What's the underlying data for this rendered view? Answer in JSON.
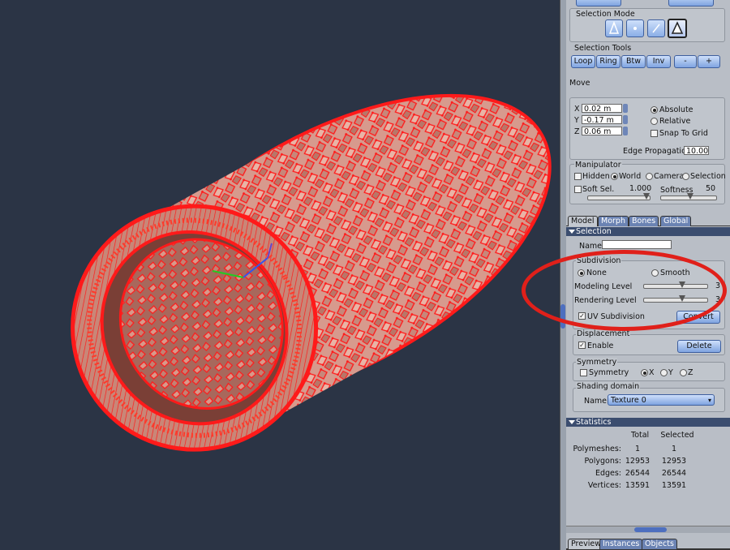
{
  "selection_mode": {
    "title": "Selection Mode",
    "icons": [
      "vertex-mode-icon",
      "point-mode-icon",
      "edge-mode-icon",
      "face-mode-icon"
    ],
    "active": "face-mode-icon"
  },
  "selection_tools": {
    "title": "Selection Tools",
    "buttons": [
      "Loop",
      "Ring",
      "Btw",
      "Inv",
      "-",
      "+"
    ]
  },
  "move": {
    "title": "Move",
    "x_label": "X",
    "x": "0.02 m",
    "y_label": "Y",
    "y": "-0.17 m",
    "z_label": "Z",
    "z": "0.06 m",
    "absolute": "Absolute",
    "relative": "Relative",
    "snap": "Snap To Grid",
    "edge_prop_label": "Edge Propagation",
    "edge_prop": "10.00"
  },
  "manipulator": {
    "title": "Manipulator",
    "hidden": "Hidden",
    "world": "World",
    "camera": "Camera",
    "selection": "Selection",
    "soft_sel": "Soft Sel.",
    "soft_val": "1.000",
    "softness": "Softness",
    "softness_val": "50"
  },
  "tabs": [
    "Model",
    "Morph",
    "Bones",
    "Global"
  ],
  "selection": {
    "header": "Selection",
    "name_label": "Name",
    "name_value": ""
  },
  "subdivision": {
    "title": "Subdivision",
    "none": "None",
    "smooth": "Smooth",
    "modeling_level_label": "Modeling Level",
    "modeling_level": "3",
    "modeling_level_fraction": 0.6,
    "rendering_level_label": "Rendering Level",
    "rendering_level": "3",
    "rendering_level_fraction": 0.6,
    "uv_subdivision": "UV Subdivision",
    "convert": "Convert"
  },
  "displacement": {
    "title": "Displacement",
    "enable": "Enable",
    "delete": "Delete"
  },
  "symmetry": {
    "title": "Symmetry",
    "label": "Symmetry",
    "x": "X",
    "y": "Y",
    "z": "Z"
  },
  "shading": {
    "title": "Shading domain",
    "name_label": "Name",
    "value": "Texture 0"
  },
  "statistics": {
    "header": "Statistics",
    "col_total": "Total",
    "col_selected": "Selected",
    "rows": [
      {
        "label": "Polymeshes:",
        "total": "1",
        "selected": "1"
      },
      {
        "label": "Polygons:",
        "total": "12953",
        "selected": "12953"
      },
      {
        "label": "Edges:",
        "total": "26544",
        "selected": "26544"
      },
      {
        "label": "Vertices:",
        "total": "13591",
        "selected": "13591"
      }
    ]
  },
  "bottom_tabs": [
    "Preview",
    "Instances",
    "Objects"
  ],
  "colors": {
    "accent": "#6b83b3",
    "wire": "#ff1a1a",
    "tire": "#d9998a",
    "annotation": "#e0201a"
  }
}
